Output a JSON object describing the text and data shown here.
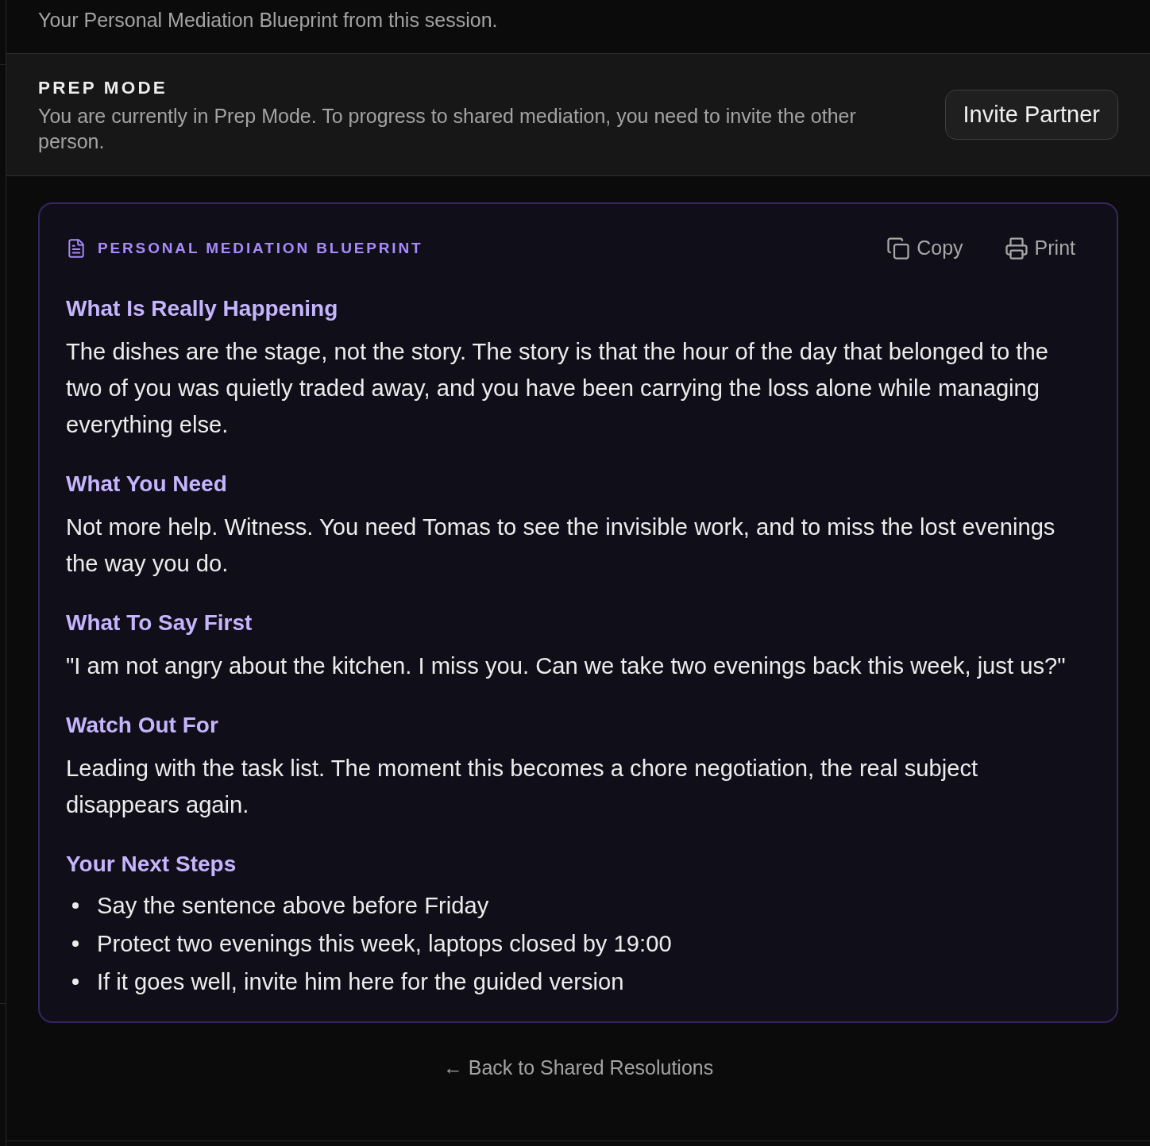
{
  "intro": "Your Personal Mediation Blueprint from this session.",
  "prep_mode": {
    "title": "PREP MODE",
    "description": "You are currently in Prep Mode. To progress to shared mediation, you need to invite the other person.",
    "button": "Invite Partner"
  },
  "blueprint": {
    "title": "PERSONAL MEDIATION BLUEPRINT",
    "actions": [
      {
        "kind": "copy",
        "label": "Copy"
      },
      {
        "kind": "print",
        "label": "Print"
      }
    ],
    "sections": [
      {
        "kind": "paragraph",
        "heading": "What Is Really Happening",
        "text": "The dishes are the stage, not the story. The story is that the hour of the day that belonged to the two of you was quietly traded away, and you have been carrying the loss alone while managing everything else."
      },
      {
        "kind": "paragraph",
        "heading": "What You Need",
        "text": "Not more help. Witness. You need Tomas to see the invisible work, and to miss the lost evenings the way you do."
      },
      {
        "kind": "paragraph",
        "heading": "What To Say First",
        "text": "\"I am not angry about the kitchen. I miss you. Can we take two evenings back this week, just us?\""
      },
      {
        "kind": "paragraph",
        "heading": "Watch Out For",
        "text": "Leading with the task list. The moment this becomes a chore negotiation, the real subject disappears again."
      },
      {
        "kind": "list",
        "heading": "Your Next Steps",
        "items": [
          "Say the sentence above before Friday",
          "Protect two evenings this week, laptops closed by 19:00",
          "If it goes well, invite him here for the guided version"
        ]
      }
    ]
  },
  "back_link": "← Back to Shared Resolutions"
}
